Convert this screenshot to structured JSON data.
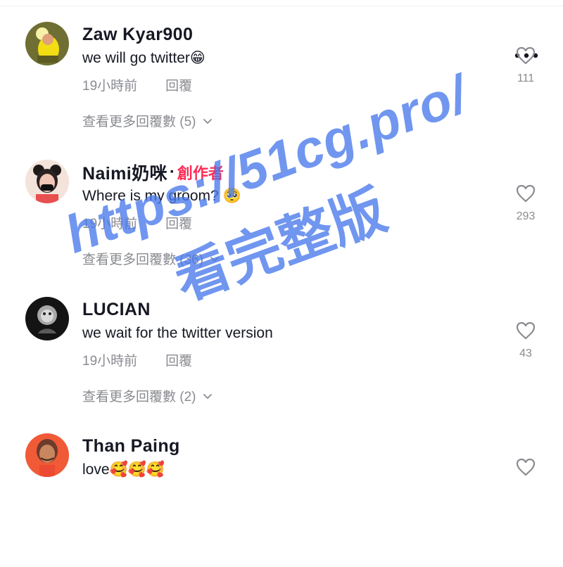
{
  "comments": [
    {
      "username": "Zaw Kyar900",
      "text": "we will go twitter😁",
      "time": "19小時前",
      "reply": "回覆",
      "likes": "111",
      "more_replies": "查看更多回覆數 (5)",
      "creator_badge": "",
      "avatar_icon": "user-avatar-icon"
    },
    {
      "username": "Naimi奶咪",
      "creator_separator": "·",
      "creator_badge": "創作者",
      "text": "Where is my groom? 🥺",
      "time": "19小時前",
      "reply": "回覆",
      "likes": "293",
      "more_replies": "查看更多回覆數 (36)",
      "avatar_icon": "user-avatar-icon"
    },
    {
      "username": "LUCIAN",
      "text": "we wait for the twitter version",
      "time": "19小時前",
      "reply": "回覆",
      "likes": "43",
      "more_replies": "查看更多回覆數 (2)",
      "creator_badge": "",
      "avatar_icon": "user-avatar-icon"
    },
    {
      "username": "Than Paing",
      "text": "love🥰🥰🥰",
      "creator_badge": "",
      "avatar_icon": "user-avatar-icon"
    }
  ],
  "overlay": {
    "watermark_line_1": "https://51cg.pro/",
    "watermark_line_2": "看完整版"
  },
  "icons": {
    "heart": "heart-icon",
    "more": "more-options-icon",
    "chevron": "chevron-down-icon"
  },
  "colors": {
    "primary_text": "#161823",
    "secondary_text": "#8a8b91",
    "creator_badge": "#fe2c55",
    "watermark": "#4878eb"
  }
}
